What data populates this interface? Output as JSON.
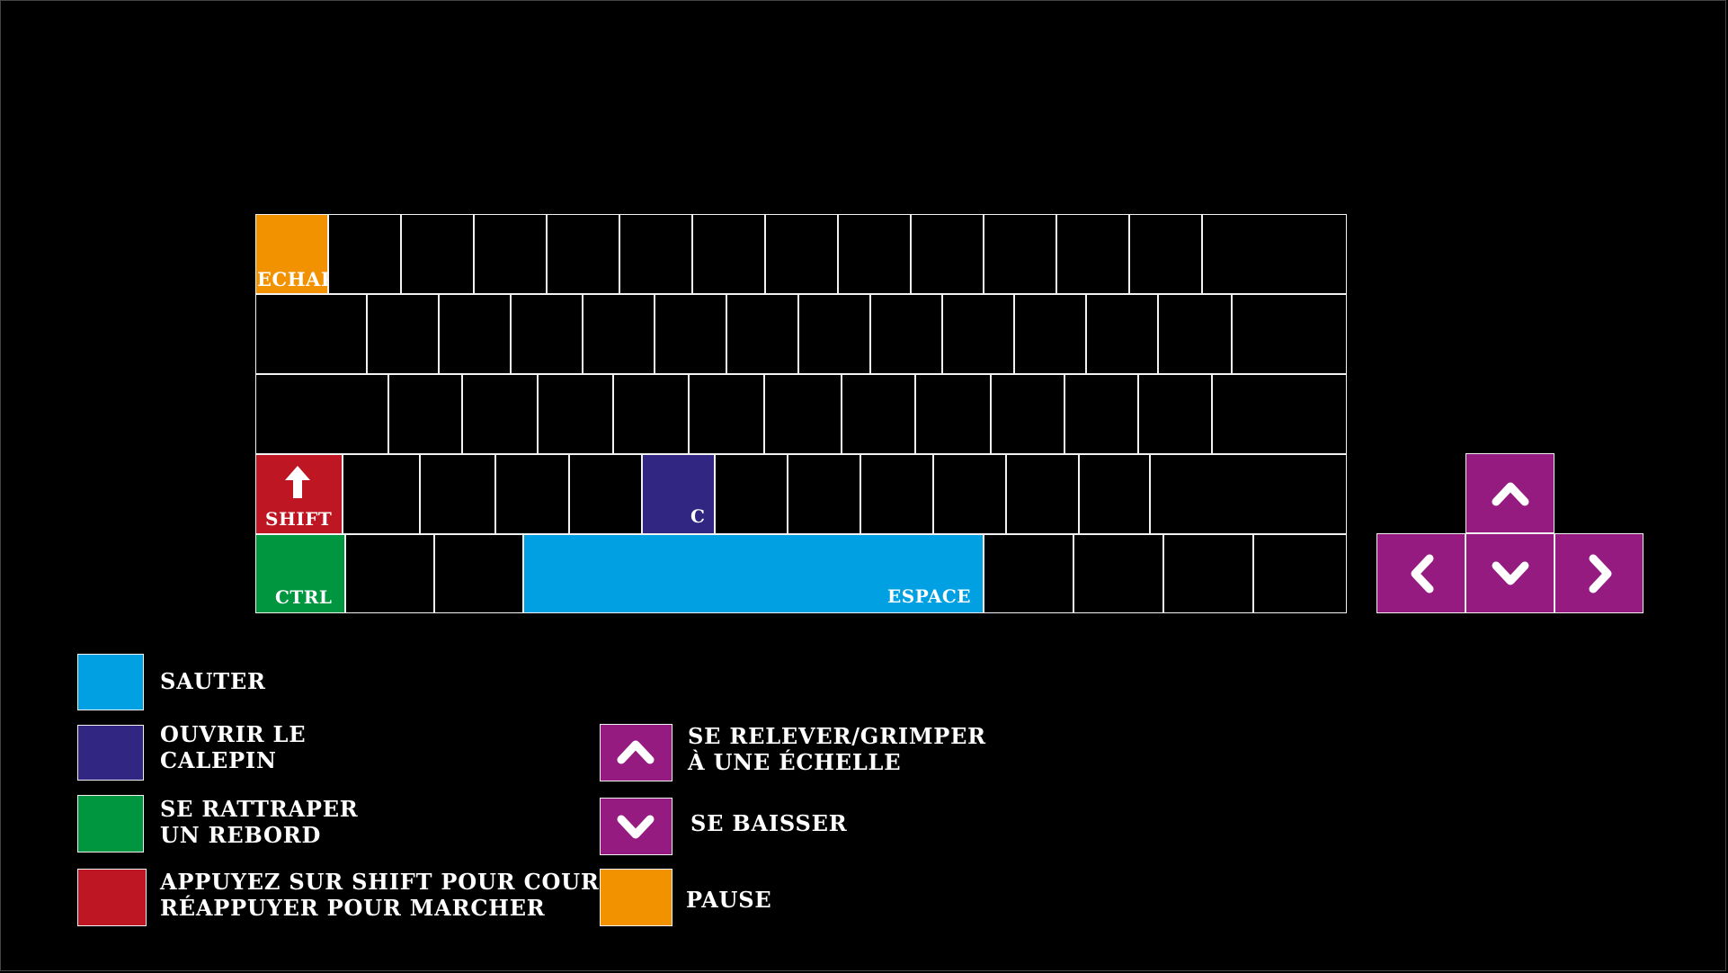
{
  "colors": {
    "background": "#000000",
    "jump": "#00a0e3",
    "notebook": "#312783",
    "ledge": "#009640",
    "run": "#be1622",
    "climb_crouch": "#951b81",
    "pause": "#f39200",
    "outline": "#f2f2f2"
  },
  "keyboard": {
    "escape_label": "ECHAP",
    "shift_label": "SHIFT",
    "c_label": "C",
    "ctrl_label": "CTRL",
    "space_label": "ESPACE"
  },
  "arrows": {
    "up_icon": "chevron-up-icon",
    "left_icon": "chevron-left-icon",
    "down_icon": "chevron-down-icon",
    "right_icon": "chevron-right-icon",
    "shift_icon": "arrow-up-icon"
  },
  "legend": {
    "jump": "SAUTER",
    "notebook_line1": "OUVRIR LE",
    "notebook_line2": "CALEPIN",
    "ledge_line1": "SE RATTRAPER",
    "ledge_line2": "UN REBORD",
    "run_line1": "APPUYEZ SUR SHIFT POUR COURIR,",
    "run_line2": "RÉAPPUYER POUR MARCHER",
    "climb_line1": "SE RELEVER/GRIMPER",
    "climb_line2": "À UNE ÉCHELLE",
    "crouch": "SE BAISSER",
    "pause": "PAUSE"
  }
}
